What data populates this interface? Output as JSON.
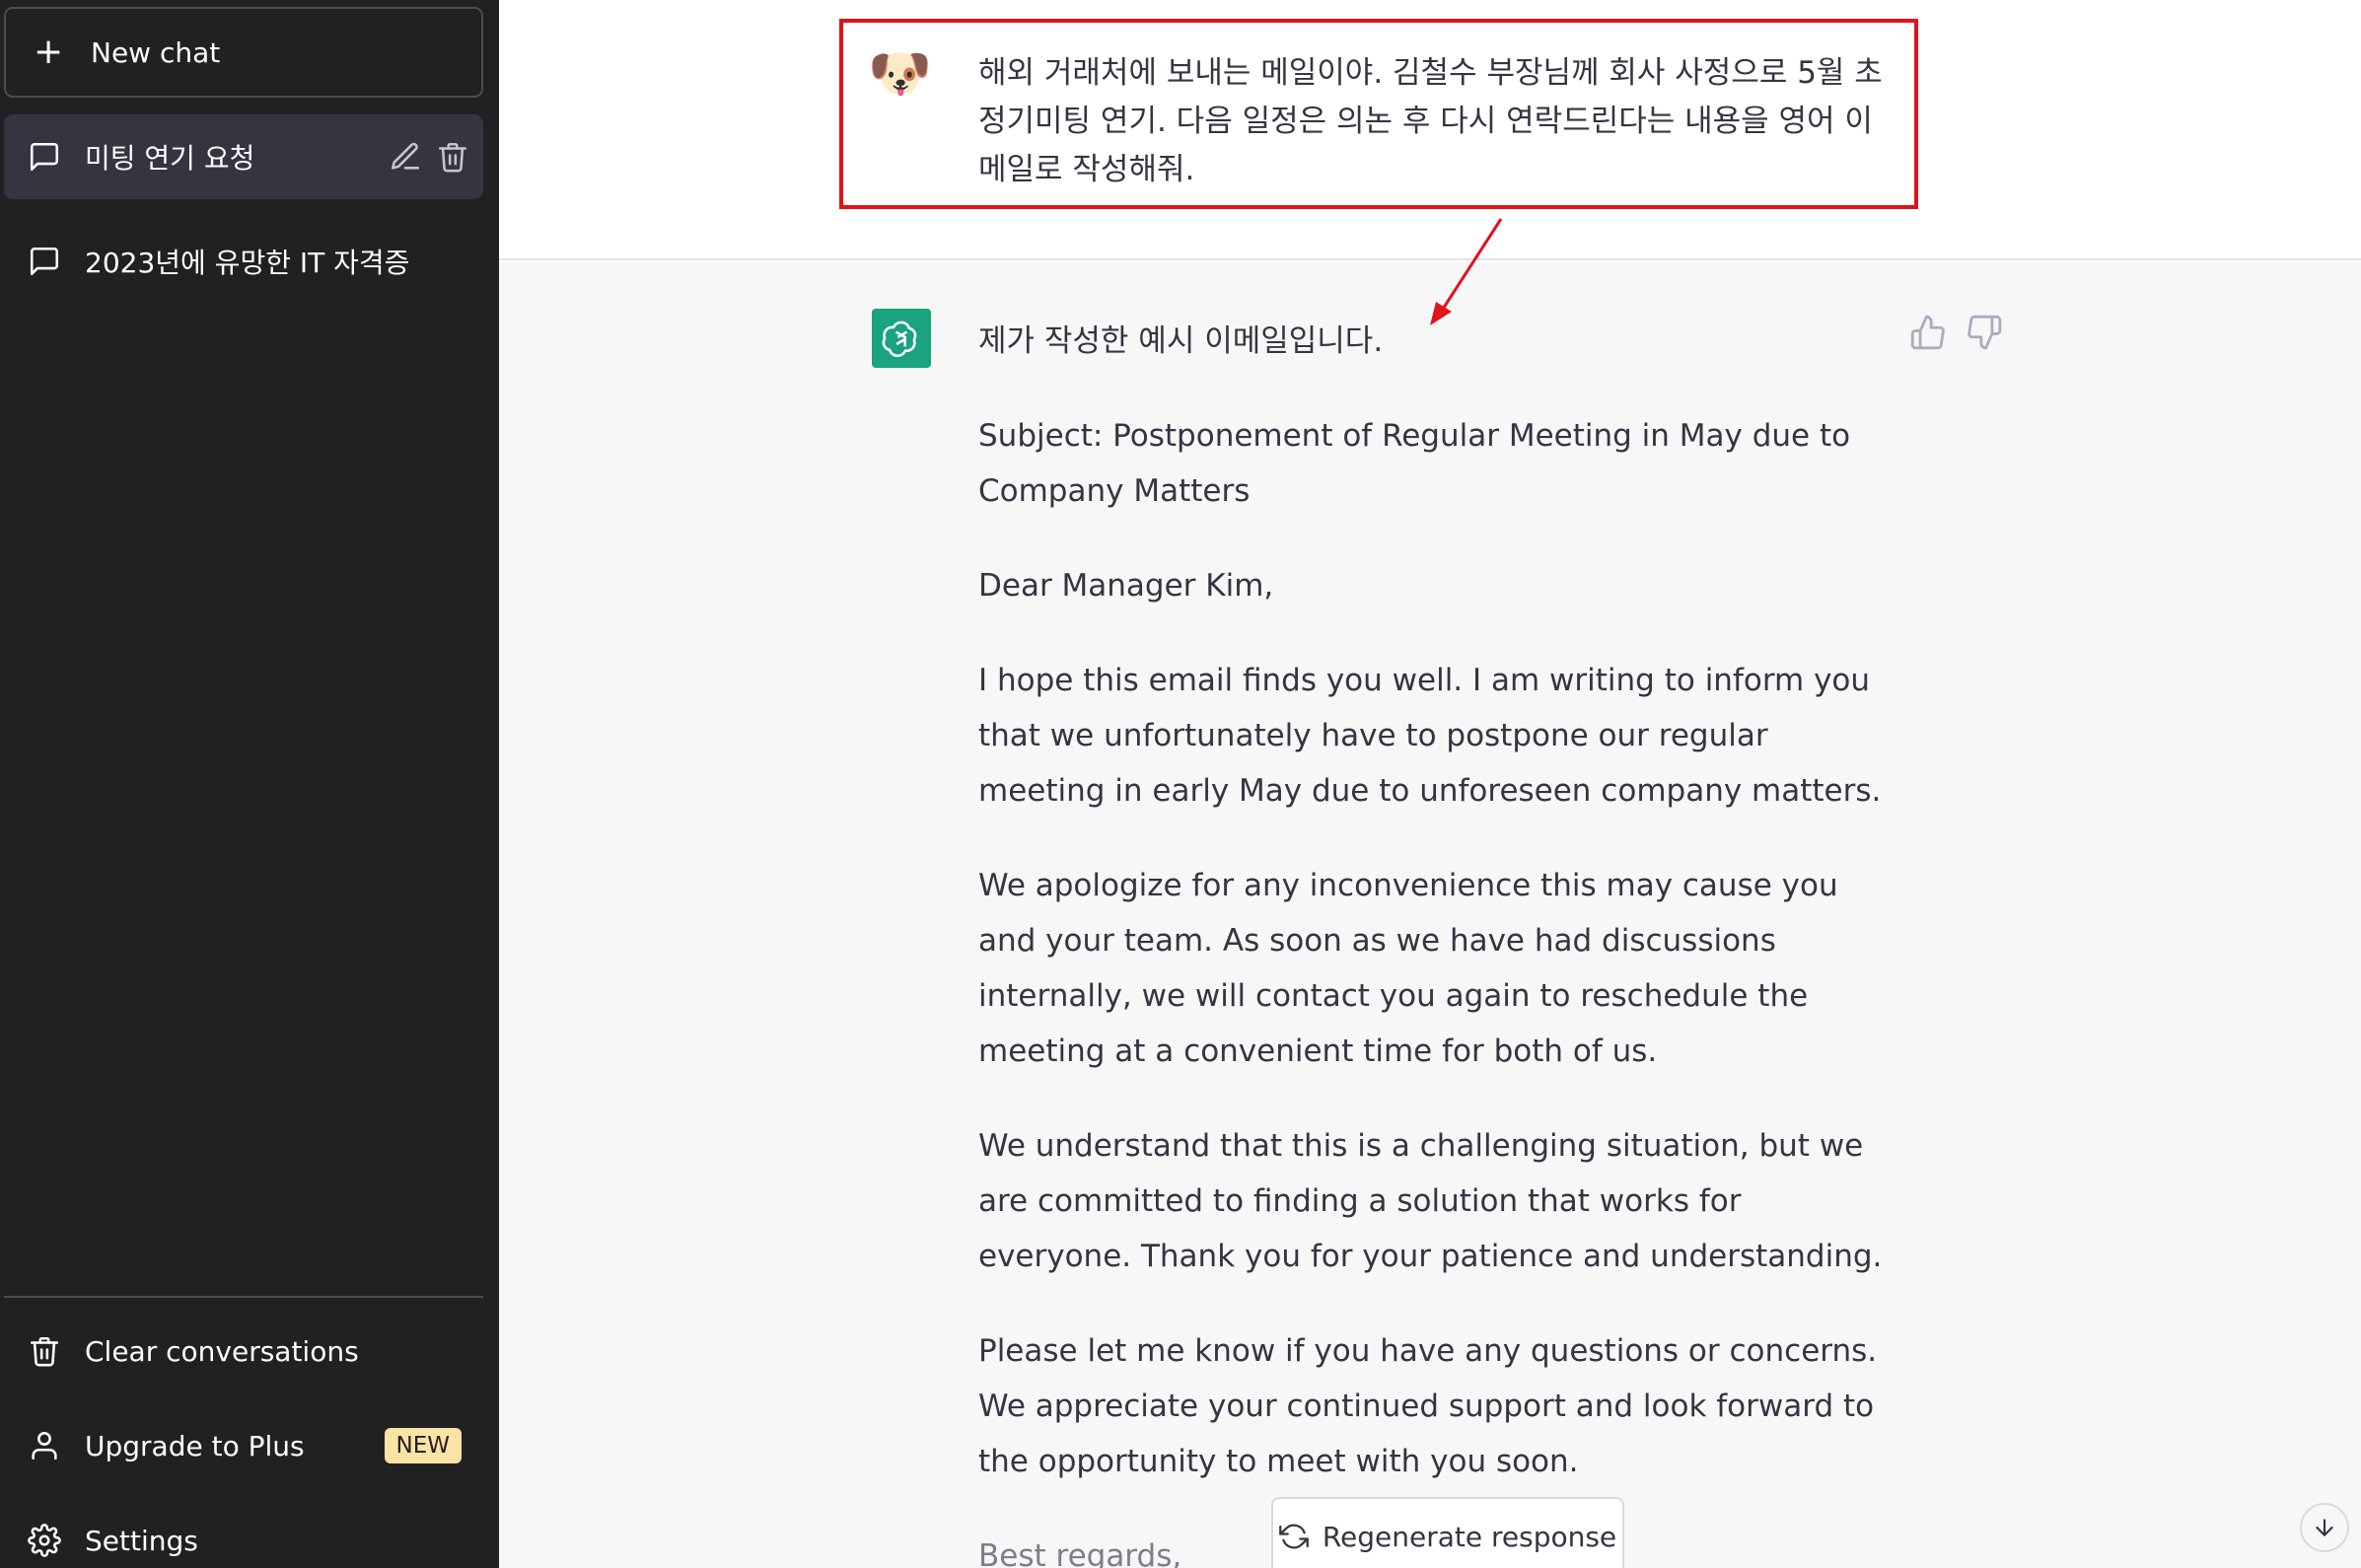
{
  "sidebar": {
    "new_chat_label": "New chat",
    "conversations": [
      {
        "label": "미팅 연기 요청",
        "active": true
      },
      {
        "label": "2023년에 유망한 IT 자격증",
        "active": false
      }
    ],
    "clear_label": "Clear conversations",
    "upgrade_label": "Upgrade to Plus",
    "upgrade_badge": "NEW",
    "settings_label": "Settings"
  },
  "conversation": {
    "user_avatar": "🐶",
    "user_message": "해외 거래처에 보내는 메일이야. 김철수 부장님께 회사 사정으로 5월 초 정기미팅 연기. 다음 일정은 의논 후 다시 연락드린다는 내용을 영어 이메일로 작성해줘.",
    "assistant_intro": "제가 작성한 예시 이메일입니다.",
    "assistant_paragraphs": [
      "Subject: Postponement of Regular Meeting in May due to Company Matters",
      "Dear Manager Kim,",
      "I hope this email finds you well. I am writing to inform you that we unfortunately have to postpone our regular meeting in early May due to unforeseen company matters.",
      "We apologize for any inconvenience this may cause you and your team. As soon as we have had discussions internally, we will contact you again to reschedule the meeting at a convenient time for both of us.",
      "We understand that this is a challenging situation, but we are committed to finding a solution that works for everyone. Thank you for your patience and understanding.",
      "Please let me know if you have any questions or concerns. We appreciate your continued support and look forward to the opportunity to meet with you soon."
    ],
    "assistant_closing": "Best regards,"
  },
  "regenerate_label": "Regenerate response",
  "colors": {
    "sidebar_bg": "#202123",
    "active_conv_bg": "#343541",
    "assistant_bg": "#f7f7f8",
    "gpt_green": "#19a37f",
    "highlight_red": "#e0131b",
    "badge_bg": "#fbe3a3"
  },
  "icons": [
    "plus-icon",
    "chat-bubble-icon",
    "pencil-icon",
    "trash-icon",
    "user-icon",
    "gear-icon",
    "thumbs-up-icon",
    "thumbs-down-icon",
    "refresh-icon",
    "arrow-down-icon",
    "openai-logo-icon"
  ]
}
